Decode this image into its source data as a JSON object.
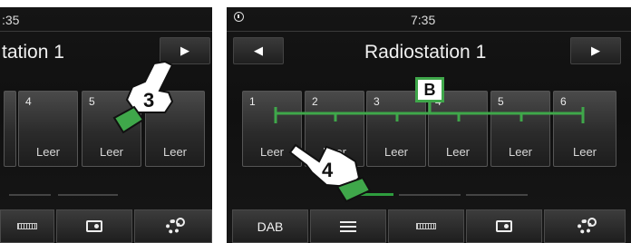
{
  "left": {
    "clock": ":35",
    "station": "tation 1",
    "next_symbol": "▶",
    "presets": [
      {
        "num": "4",
        "label": "Leer"
      },
      {
        "num": "5",
        "label": "Leer"
      },
      {
        "num": "",
        "label": "Leer"
      }
    ],
    "bottom": [
      "strip-icon",
      "radio-icon",
      "gear-icon"
    ]
  },
  "right": {
    "clock": "7:35",
    "station": "Radiostation 1",
    "prev_symbol": "◀",
    "next_symbol": "▶",
    "presets": [
      {
        "num": "1",
        "label": "Leer"
      },
      {
        "num": "2",
        "label": "Leer"
      },
      {
        "num": "3",
        "label": "Leer"
      },
      {
        "num": "4",
        "label": "Leer"
      },
      {
        "num": "5",
        "label": "Leer"
      },
      {
        "num": "6",
        "label": "Leer"
      }
    ],
    "bottom": {
      "dab": "DAB"
    }
  },
  "annotations": {
    "callout_3": "3",
    "callout_4": "4",
    "label_b": "B",
    "accent": "#3fa74a"
  }
}
